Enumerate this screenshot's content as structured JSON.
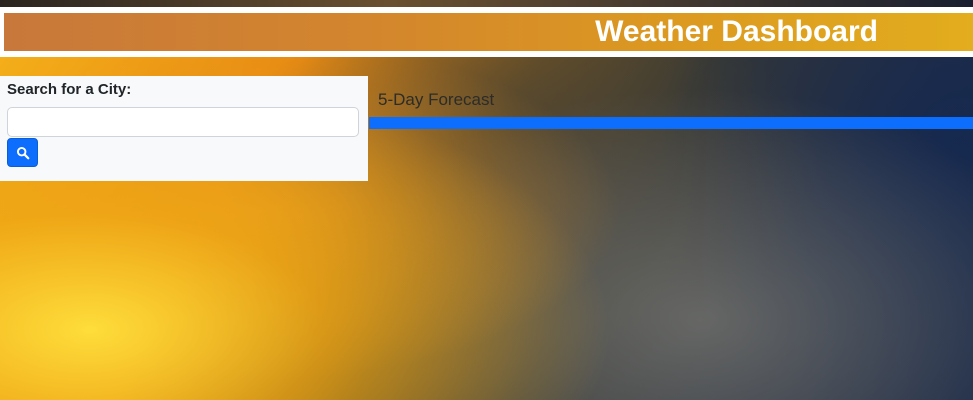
{
  "header": {
    "title": "Weather Dashboard"
  },
  "search": {
    "label": "Search for a City:",
    "input_value": "",
    "placeholder": "",
    "button_icon": "search-icon"
  },
  "forecast": {
    "heading": "5-Day Forecast"
  },
  "colors": {
    "header_bar_start": "#c8783a",
    "header_bar_end": "#e2ad1e",
    "accent_blue": "#0d6efd",
    "panel_background": "#f8f9fa"
  }
}
